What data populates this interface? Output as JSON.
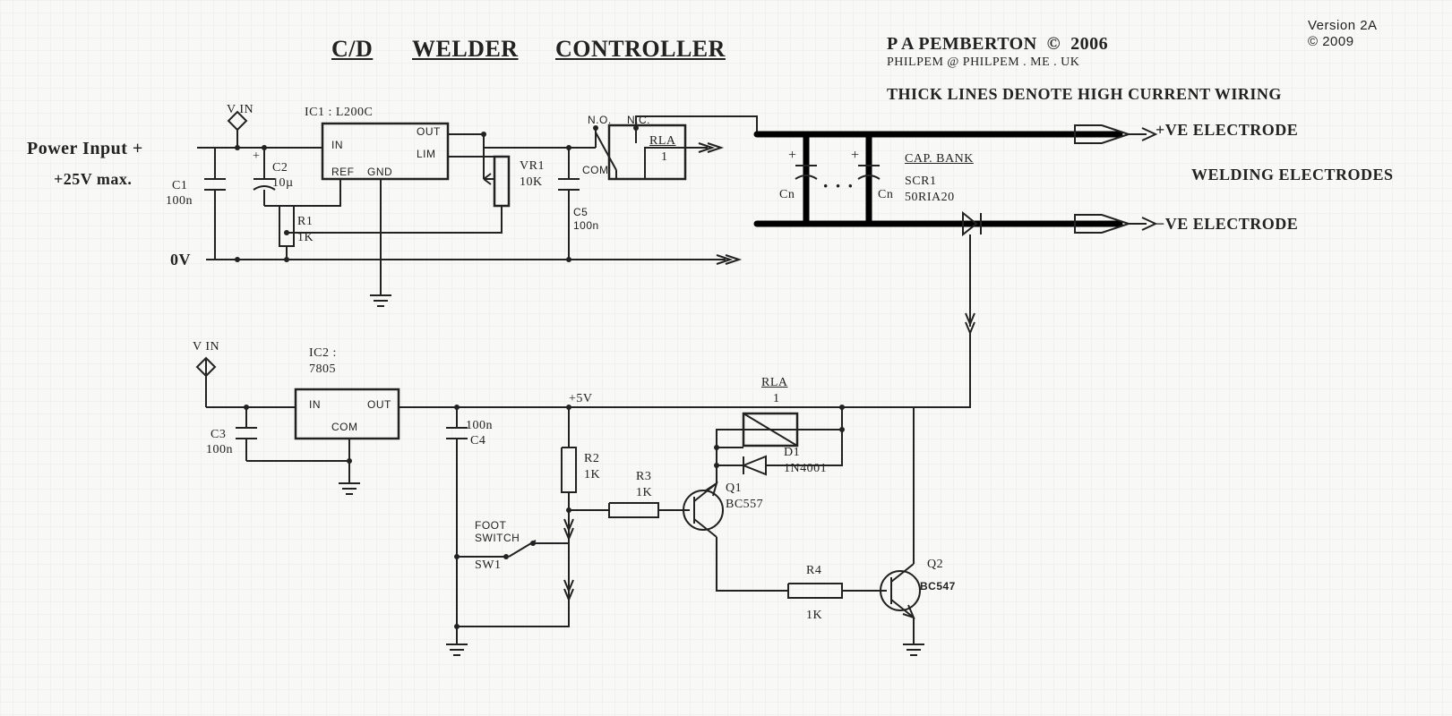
{
  "version": {
    "line1": "Version 2A",
    "line2": "© 2009"
  },
  "title": {
    "w1": "C/D",
    "w2": "WELDER",
    "w3": "CONTROLLER"
  },
  "author": {
    "line1": "P A PEMBERTON  ©  2006",
    "line2": "PHILPEM @ PHILPEM . ME . UK"
  },
  "note_thick": "THICK LINES DENOTE HIGH CURRENT WIRING",
  "electrodes": {
    "pos": "+VE ELECTRODE",
    "neg": "−VE ELECTRODE",
    "label": "WELDING ELECTRODES"
  },
  "power": {
    "in": "Power Input +",
    "max": "+25V max.",
    "zero": "0V",
    "vin1": "V IN",
    "vin2": "V IN"
  },
  "ic1": {
    "ref": "IC1 : L200C",
    "in": "IN",
    "ref_pin": "REF",
    "gnd": "GND",
    "out": "OUT",
    "lim": "LIM"
  },
  "ic2": {
    "ref": "IC2 :",
    "part": "7805",
    "in": "IN",
    "out": "OUT",
    "com": "COM"
  },
  "c": {
    "c1": "C1",
    "c1v": "100n",
    "c2": "C2",
    "c2v": "10µ",
    "c3": "C3",
    "c3v": "100n",
    "c4": "C4",
    "c4v": "100n",
    "c5": "C5",
    "c5v": "100n",
    "bank": "CAP. BANK",
    "cn": "Cn",
    "dots": "· · ·"
  },
  "r": {
    "r1": "R1",
    "r1v": "1K",
    "r2": "R2",
    "r2v": "1K",
    "r3": "R3",
    "r3v": "1K",
    "r4": "R4",
    "r4v": "1K",
    "vr1": "VR1",
    "vr1v": "10K"
  },
  "relay": {
    "top": "RLA",
    "top2": "1",
    "coil": "RLA",
    "coil2": "1",
    "no": "N.O.",
    "nc": "N.C.",
    "com": "COM"
  },
  "scr": {
    "ref": "SCR1",
    "part": "50RIA20"
  },
  "q": {
    "q1": "Q1",
    "q1p": "BC557",
    "q2": "Q2",
    "q2p": "BC547"
  },
  "d": {
    "d1": "D1",
    "d1p": "1N4001"
  },
  "sw": {
    "lbl": "FOOT",
    "lbl2": "SWITCH",
    "ref": "SW1"
  },
  "five": "+5V"
}
